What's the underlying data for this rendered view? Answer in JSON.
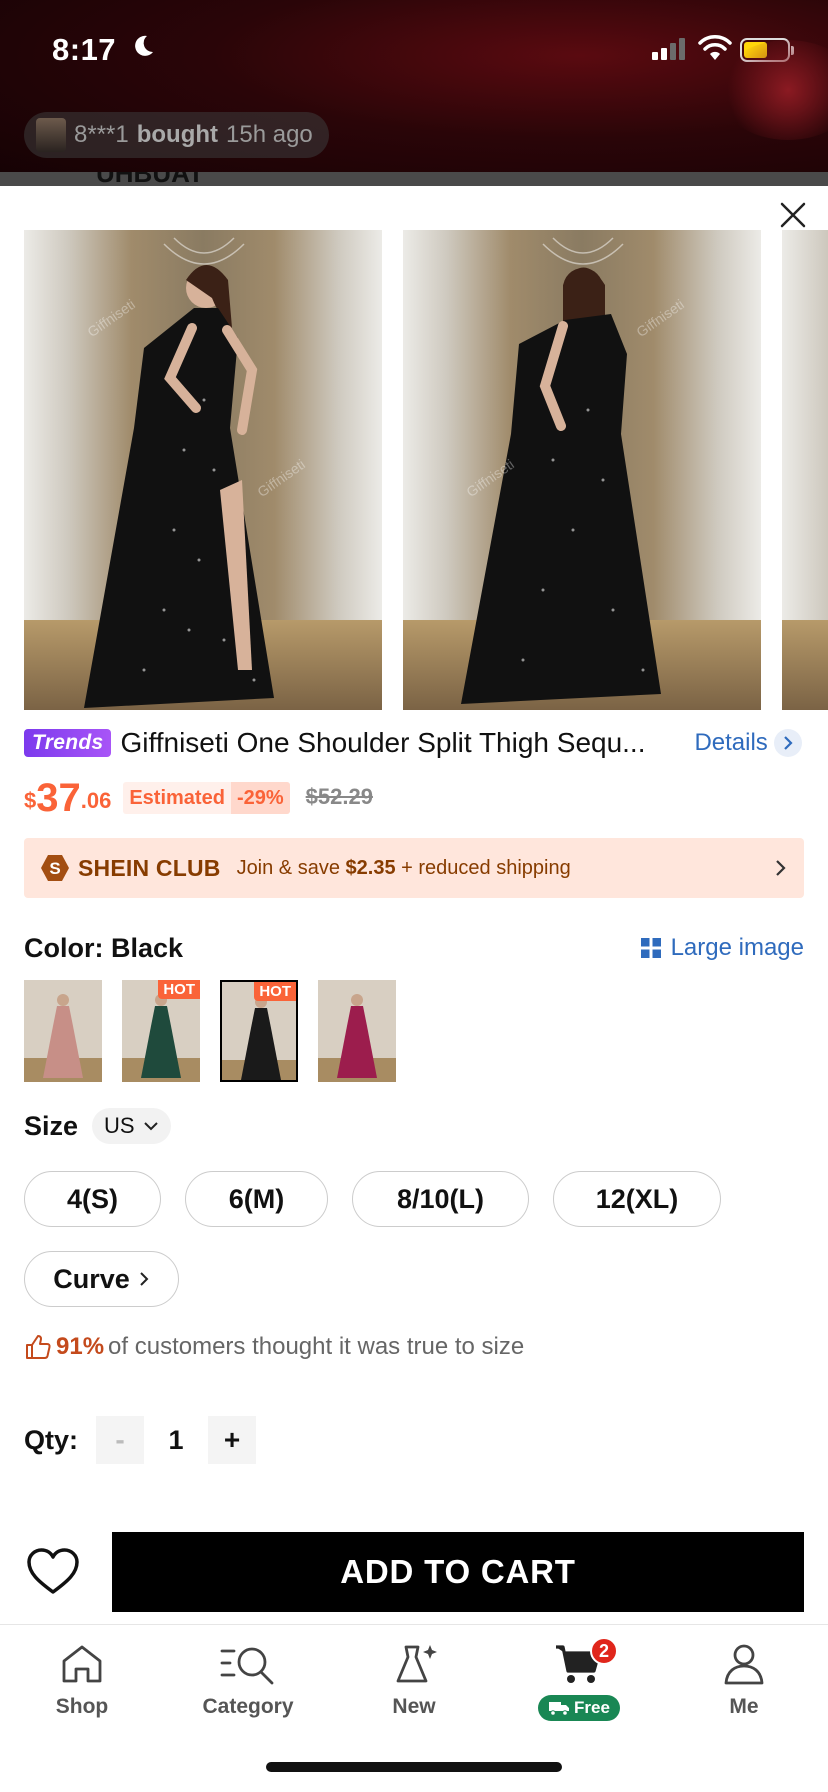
{
  "status_bar": {
    "time": "8:17"
  },
  "notification": {
    "masked_user": "8***1",
    "action": "bought",
    "when": "15h ago"
  },
  "background_peek": {
    "text": "UHBUAT"
  },
  "watermark": "Giffniseti",
  "product": {
    "badge": "Trends",
    "title": "Giffniseti One Shoulder Split Thigh Sequ...",
    "details_label": "Details",
    "price": {
      "currency": "$",
      "integer": "37",
      "decimal": ".06"
    },
    "estimated_label": "Estimated",
    "discount": "-29%",
    "original_price": "$52.29"
  },
  "club": {
    "name": "SHEIN CLUB",
    "message_prefix": "Join & save ",
    "save_amount": "$2.35",
    "message_suffix": " + reduced shipping"
  },
  "color": {
    "label": "Color: Black",
    "large_image_label": "Large image",
    "hot_label": "HOT",
    "options": [
      {
        "name": "Pink",
        "hot": false,
        "selected": false,
        "dress": "#c78f87"
      },
      {
        "name": "Green",
        "hot": true,
        "selected": false,
        "dress": "#1f4a3c"
      },
      {
        "name": "Black",
        "hot": true,
        "selected": true,
        "dress": "#1a1a1a"
      },
      {
        "name": "Burgundy",
        "hot": false,
        "selected": false,
        "dress": "#9c1d4d"
      }
    ]
  },
  "size": {
    "label": "Size",
    "unit": "US",
    "options": [
      "4(S)",
      "6(M)",
      "8/10(L)",
      "12(XL)"
    ],
    "curve_label": "Curve"
  },
  "fit": {
    "percent": "91%",
    "text": " of customers thought it was true to size"
  },
  "quantity": {
    "label": "Qty:",
    "minus": "-",
    "value": "1",
    "plus": "+"
  },
  "cta": {
    "add_to_cart": "ADD TO CART"
  },
  "tabbar": {
    "items": [
      {
        "label": "Shop",
        "icon": "home-icon"
      },
      {
        "label": "Category",
        "icon": "category-search-icon"
      },
      {
        "label": "New",
        "icon": "dress-sparkle-icon"
      },
      {
        "label": "",
        "icon": "cart-icon",
        "badge": "2",
        "pill": "Free"
      },
      {
        "label": "Me",
        "icon": "person-icon"
      }
    ]
  },
  "colors": {
    "accent": "#fa6338",
    "link": "#2f6bbd",
    "club_text": "#873c00",
    "free_green": "#198754"
  }
}
